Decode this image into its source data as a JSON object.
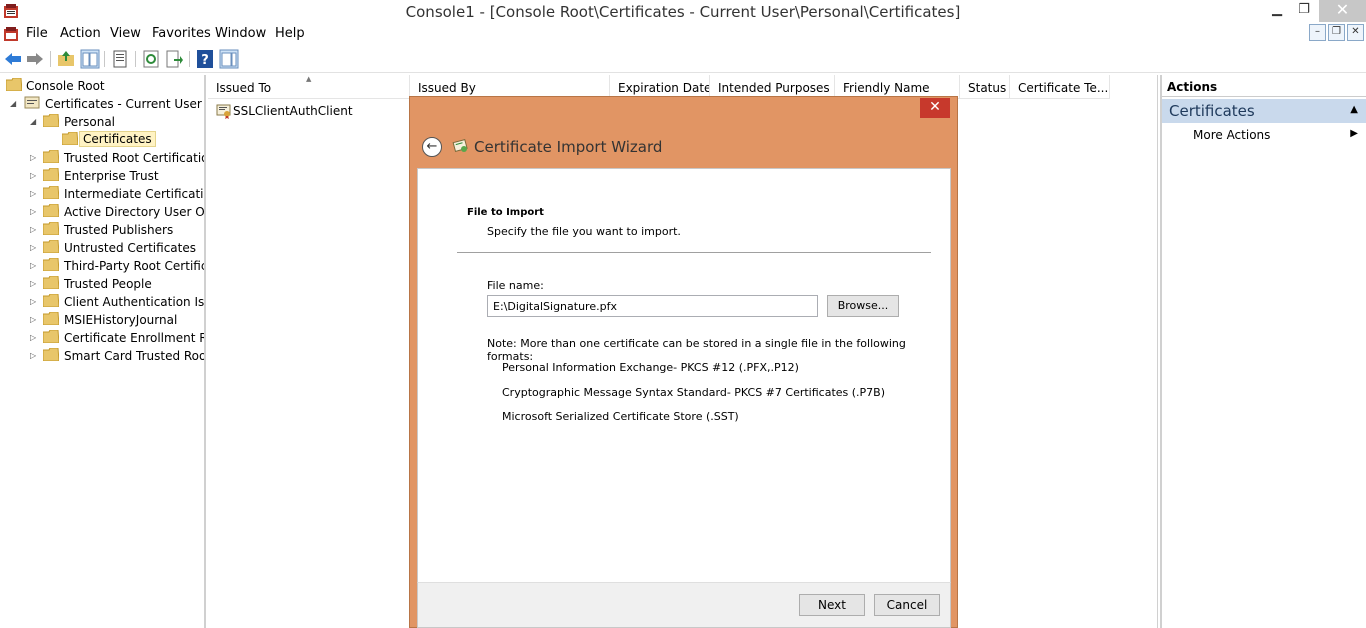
{
  "window": {
    "title": "Console1 - [Console Root\\Certificates - Current User\\Personal\\Certificates]",
    "minimize": "▁",
    "restore": "❐",
    "close": "✕"
  },
  "menu": [
    "File",
    "Action",
    "View",
    "Favorites",
    "Window",
    "Help"
  ],
  "mdi": {
    "minimize": "–",
    "restore": "❐",
    "close": "✕"
  },
  "tree": {
    "root": "Console Root",
    "store": "Certificates - Current User",
    "personal": "Personal",
    "certificates": "Certificates",
    "stores": [
      "Trusted Root Certification Authorities",
      "Enterprise Trust",
      "Intermediate Certification Authorities",
      "Active Directory User Object",
      "Trusted Publishers",
      "Untrusted Certificates",
      "Third-Party Root Certification Authorities",
      "Trusted People",
      "Client Authentication Issuers",
      "MSIEHistoryJournal",
      "Certificate Enrollment Requests",
      "Smart Card Trusted Roots"
    ]
  },
  "list": {
    "columns": [
      "Issued To",
      "Issued By",
      "Expiration Date",
      "Intended Purposes",
      "Friendly Name",
      "Status",
      "Certificate Te..."
    ],
    "rows": [
      {
        "issued_to": "SSLClientAuthClient"
      }
    ]
  },
  "actions": {
    "header": "Actions",
    "section": "Certificates",
    "more_actions": "More Actions"
  },
  "wizard": {
    "title": "Certificate Import Wizard",
    "close": "✕",
    "section_title": "File to Import",
    "section_subtitle": "Specify the file you want to import.",
    "file_name_label": "File name:",
    "file_name_value": "E:\\DigitalSignature.pfx",
    "browse": "Browse...",
    "note": "Note:  More than one certificate can be stored in a single file in the following formats:",
    "formats": [
      "Personal Information Exchange- PKCS #12 (.PFX,.P12)",
      "Cryptographic Message Syntax Standard- PKCS #7 Certificates (.P7B)",
      "Microsoft Serialized Certificate Store (.SST)"
    ],
    "next": "Next",
    "cancel": "Cancel"
  }
}
